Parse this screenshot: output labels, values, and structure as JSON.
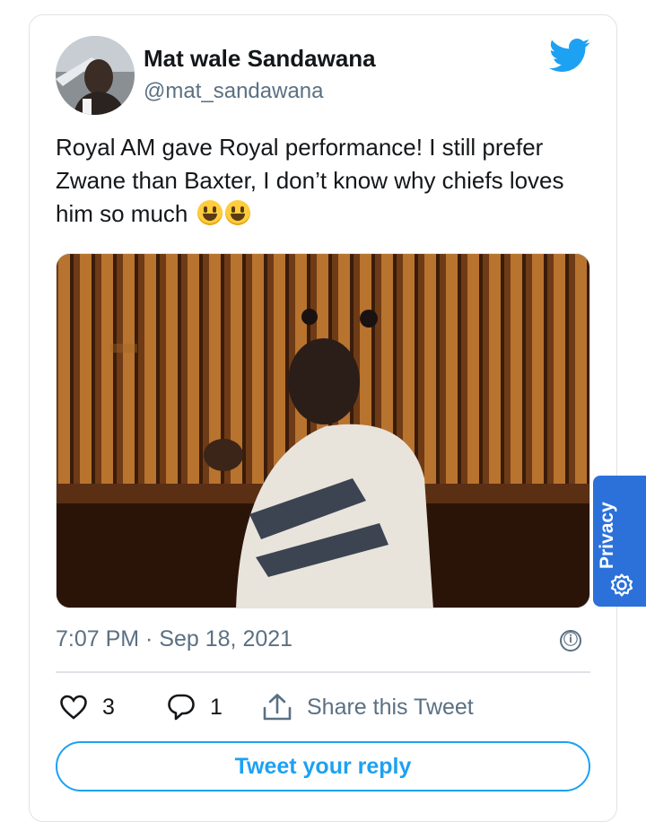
{
  "tweet": {
    "display_name": "Mat wale Sandawana",
    "handle": "@mat_sandawana",
    "text": "Royal AM gave Royal performance! I still prefer Zwane than Baxter, I don’t know why chiefs loves him so much",
    "emoji": [
      "grinning-face",
      "grinning-face"
    ],
    "timestamp": "7:07 PM · Sep 18, 2021",
    "info_icon": "ⓘ"
  },
  "actions": {
    "like_count": "3",
    "reply_count": "1",
    "share_label": "Share this Tweet"
  },
  "reply_button": {
    "label": "Tweet your reply"
  },
  "privacy_tab": {
    "label": "Privacy"
  },
  "colors": {
    "accent": "#1da1f2",
    "privacy_tab": "#2b71d9",
    "secondary_text": "#5b7083",
    "border": "#dfe3e7"
  },
  "icons": [
    "twitter-bird-icon",
    "heart-icon",
    "reply-bubble-icon",
    "share-icon",
    "info-icon",
    "gear-icon"
  ]
}
